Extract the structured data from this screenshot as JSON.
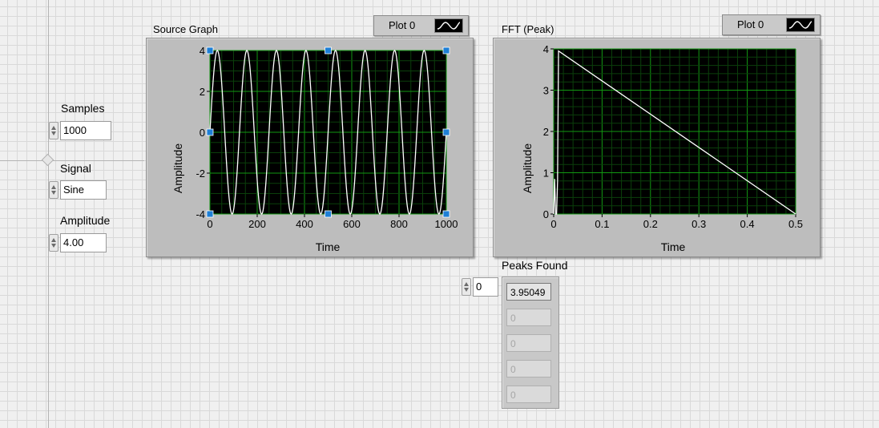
{
  "controls": {
    "samples": {
      "label": "Samples",
      "value": "1000"
    },
    "signal": {
      "label": "Signal",
      "value": "Sine"
    },
    "amplitude": {
      "label": "Amplitude",
      "value": "4.00"
    }
  },
  "source_graph": {
    "title": "Source Graph",
    "legend_label": "Plot 0",
    "ylabel": "Amplitude",
    "xlabel": "Time"
  },
  "fft_graph": {
    "title": "FFT (Peak)",
    "legend_label": "Plot 0",
    "ylabel": "Amplitude",
    "xlabel": "Time"
  },
  "peaks": {
    "label": "Peaks Found",
    "index": "0",
    "values": [
      "3.95049",
      "0",
      "0",
      "0",
      "0"
    ]
  },
  "colors": {
    "plot_bg": "#000000",
    "grid_major": "#129912",
    "grid_minor": "#0b3f0b",
    "trace": "#ffffff",
    "cursor": "#1e7fd6"
  },
  "chart_data": [
    {
      "type": "line",
      "title": "Source Graph",
      "xlabel": "Time",
      "ylabel": "Amplitude",
      "xlim": [
        0,
        1000
      ],
      "ylim": [
        -4,
        4
      ],
      "x_ticks": [
        "0",
        "200",
        "400",
        "600",
        "800",
        "1000"
      ],
      "y_ticks": [
        "-4",
        "-2",
        "0",
        "2",
        "4"
      ],
      "grid": true,
      "series": [
        {
          "name": "Plot 0",
          "function": "sine",
          "amplitude": 4,
          "cycles": 8,
          "x": [
            0,
            1000
          ]
        }
      ],
      "legend": "top-right"
    },
    {
      "type": "line",
      "title": "FFT (Peak)",
      "xlabel": "Time",
      "ylabel": "Amplitude",
      "xlim": [
        0,
        0.5
      ],
      "ylim": [
        0,
        4
      ],
      "x_ticks": [
        "0",
        "0.1",
        "0.2",
        "0.3",
        "0.4",
        "0.5"
      ],
      "y_ticks": [
        "0",
        "1",
        "2",
        "3",
        "4"
      ],
      "grid": true,
      "series": [
        {
          "name": "Plot 0",
          "x": [
            0,
            0.002,
            0.004,
            0.006,
            0.008,
            0.01,
            0.5
          ],
          "y": [
            0,
            0.85,
            0,
            0,
            0.8,
            3.95,
            0
          ]
        }
      ],
      "legend": "top-right"
    }
  ]
}
